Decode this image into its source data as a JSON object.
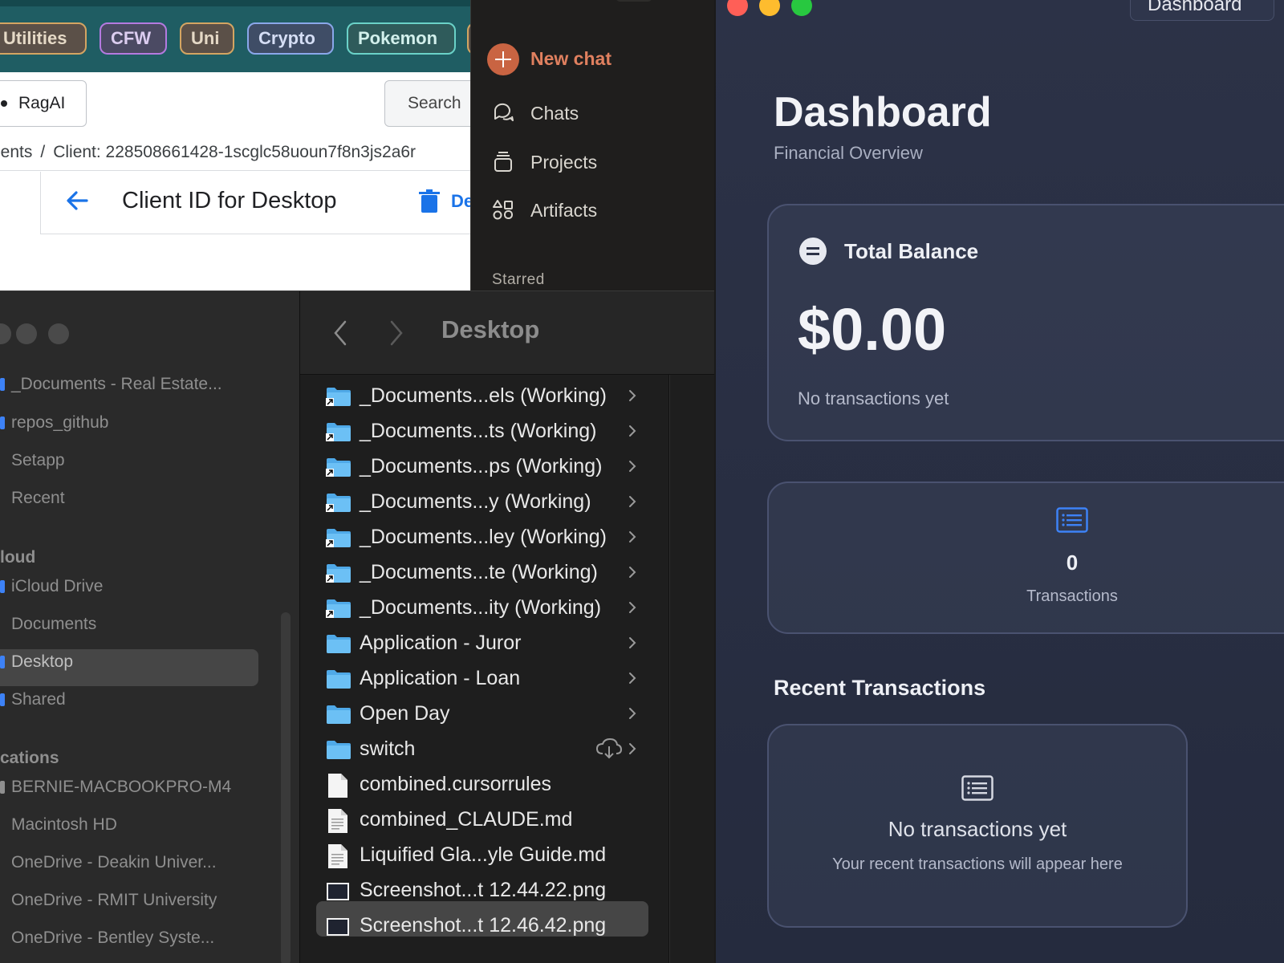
{
  "browser": {
    "bookmarks": [
      "Utilities",
      "CFW",
      "Uni",
      "Crypto",
      "Pokemon"
    ],
    "ragai_label": "RagAI",
    "search_label": "Search",
    "breadcrumb": {
      "parent": "ients",
      "separator": "/",
      "current": "Client: 228508661428-1scglc58uoun7f8n3js2a6r"
    },
    "page_title": "Client ID for Desktop",
    "delete_label": "De"
  },
  "claude": {
    "new_chat": "New chat",
    "items": [
      {
        "label": "Chats",
        "icon": "chat-bubbles-icon"
      },
      {
        "label": "Projects",
        "icon": "projects-icon"
      },
      {
        "label": "Artifacts",
        "icon": "artifacts-icon"
      }
    ],
    "starred_label": "Starred"
  },
  "finder": {
    "sidebar": {
      "items_top": [
        "_Documents - Real Estate...",
        "repos_github",
        "Setapp",
        "Recent"
      ],
      "icloud_header": "loud",
      "icloud_items": [
        "iCloud Drive",
        "Documents",
        "Desktop",
        "Shared"
      ],
      "locations_header": "cations",
      "location_items": [
        "BERNIE-MACBOOKPRO-M4",
        "Macintosh HD",
        "OneDrive - Deakin Univer...",
        "OneDrive - RMIT University",
        "OneDrive - Bentley Syste..."
      ],
      "selected": "Desktop"
    },
    "title": "Desktop",
    "files": [
      {
        "name": "_Documents...els (Working)",
        "kind": "alias-folder",
        "chevron": true
      },
      {
        "name": "_Documents...ts (Working)",
        "kind": "alias-folder",
        "chevron": true
      },
      {
        "name": "_Documents...ps (Working)",
        "kind": "alias-folder",
        "chevron": true
      },
      {
        "name": "_Documents...y (Working)",
        "kind": "alias-folder",
        "chevron": true
      },
      {
        "name": "_Documents...ley (Working)",
        "kind": "alias-folder",
        "chevron": true
      },
      {
        "name": "_Documents...te (Working)",
        "kind": "alias-folder",
        "chevron": true
      },
      {
        "name": "_Documents...ity (Working)",
        "kind": "alias-folder",
        "chevron": true
      },
      {
        "name": "Application - Juror",
        "kind": "folder",
        "chevron": true
      },
      {
        "name": "Application - Loan",
        "kind": "folder",
        "chevron": true
      },
      {
        "name": "Open Day",
        "kind": "folder",
        "chevron": true
      },
      {
        "name": "switch",
        "kind": "folder",
        "chevron": true,
        "cloud": true
      },
      {
        "name": "combined.cursorrules",
        "kind": "file"
      },
      {
        "name": "combined_CLAUDE.md",
        "kind": "doc"
      },
      {
        "name": "Liquified Gla...yle Guide.md",
        "kind": "doc"
      },
      {
        "name": "Screenshot...t 12.44.22.png",
        "kind": "image"
      },
      {
        "name": "Screenshot...t 12.46.42.png",
        "kind": "image",
        "selected": true
      }
    ]
  },
  "dashboard": {
    "window_tab": "Dashboard",
    "title": "Dashboard",
    "subtitle": "Financial Overview",
    "balance_label": "Total Balance",
    "balance_amount": "$0.00",
    "balance_note": "No transactions yet",
    "tx_count": "0",
    "tx_label": "Transactions",
    "recent_title": "Recent Transactions",
    "recent_empty_title": "No transactions yet",
    "recent_empty_sub": "Your recent transactions will appear here",
    "colors": {
      "accent_blue": "#3d82f7",
      "mac_red": "#ff5f57",
      "mac_yellow": "#febc2e",
      "mac_green": "#28c840"
    }
  }
}
